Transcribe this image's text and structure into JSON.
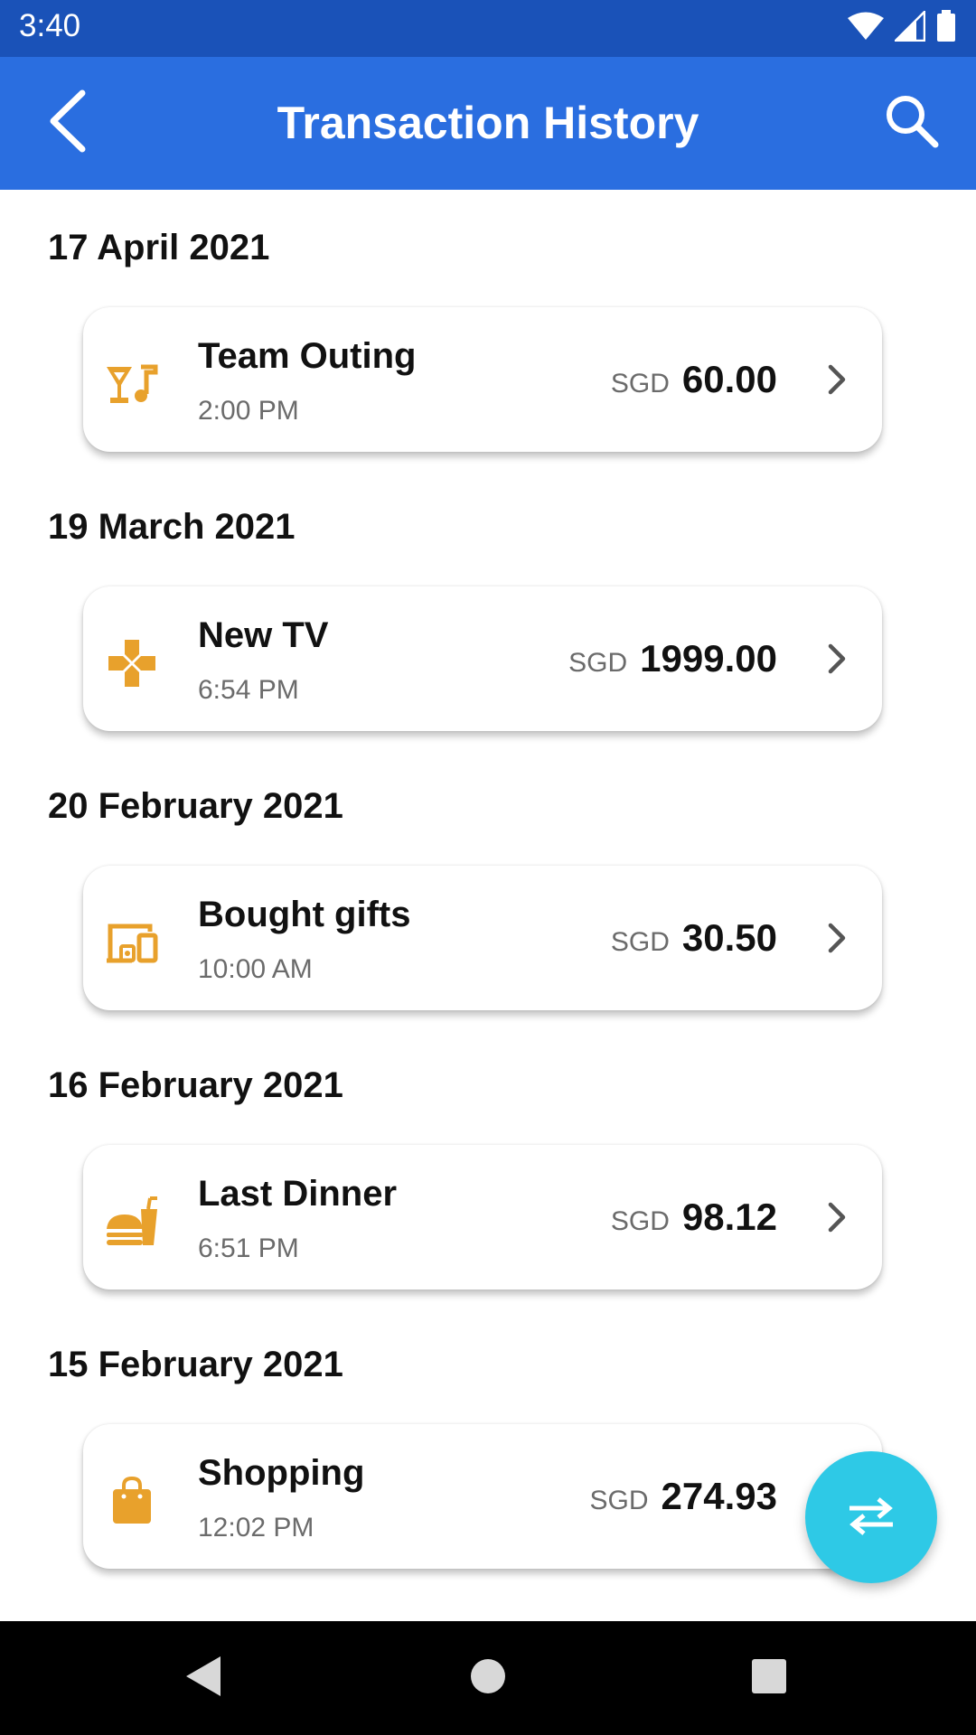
{
  "status_bar": {
    "time": "3:40",
    "icons": [
      "wifi-icon",
      "signal-icon",
      "battery-icon"
    ]
  },
  "app_bar": {
    "title": "Transaction History",
    "back_icon": "chevron-left-icon",
    "search_icon": "search-icon"
  },
  "sections": [
    {
      "date": "17 April 2021",
      "transaction": {
        "title": "Team Outing",
        "time": "2:00 PM",
        "currency": "SGD",
        "amount": "60.00",
        "icon": "nightlife-icon"
      }
    },
    {
      "date": "19 March 2021",
      "transaction": {
        "title": "New TV",
        "time": "6:54 PM",
        "currency": "SGD",
        "amount": "1999.00",
        "icon": "gamepad-icon"
      }
    },
    {
      "date": "20 February 2021",
      "transaction": {
        "title": "Bought gifts",
        "time": "10:00 AM",
        "currency": "SGD",
        "amount": "30.50",
        "icon": "devices-icon"
      }
    },
    {
      "date": "16 February 2021",
      "transaction": {
        "title": "Last Dinner",
        "time": "6:51 PM",
        "currency": "SGD",
        "amount": "98.12",
        "icon": "fastfood-icon"
      }
    },
    {
      "date": "15 February 2021",
      "transaction": {
        "title": "Shopping",
        "time": "12:02 PM",
        "currency": "SGD",
        "amount": "274.93",
        "icon": "shopping-bag-icon"
      }
    }
  ],
  "fab": {
    "icon": "swap-horiz-icon"
  },
  "nav_bar": {
    "icons": [
      "back-triangle-icon",
      "home-circle-icon",
      "recents-square-icon"
    ]
  },
  "colors": {
    "status_bar": "#1a52b8",
    "app_bar": "#2a6ee0",
    "icon_accent": "#e8a12c",
    "fab": "#2ec9e6"
  }
}
